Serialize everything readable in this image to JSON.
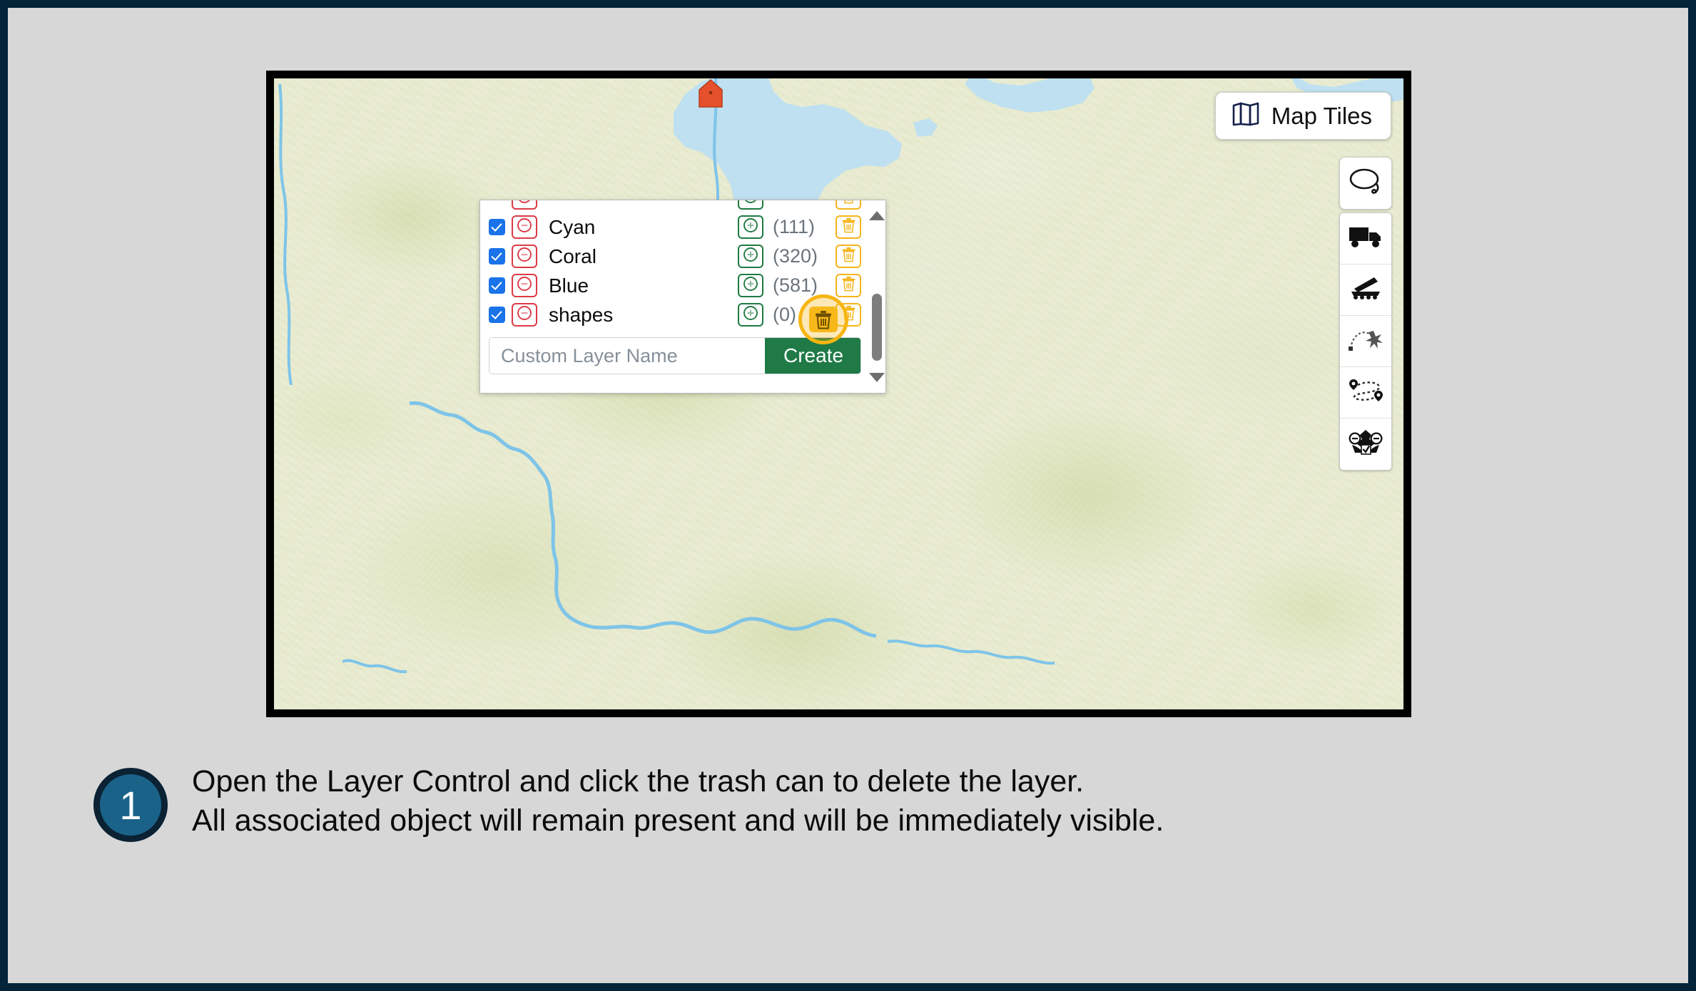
{
  "colors": {
    "outer_border": "#04243a",
    "page_background": "#d7d7d7",
    "map_frame": "#000000",
    "terrain": "#e9ecd2",
    "water": "#bfe0f0",
    "river": "#7ec4e8",
    "marker": "#e5512c",
    "checkbox_blue": "#1a73e8",
    "remove_red": "#dc3a47",
    "add_green": "#1e7a43",
    "trash_amber": "#f5b51b",
    "create_green": "#1f7a46",
    "count_gray": "#6c757d",
    "badge_fill": "#1b6289",
    "badge_ring": "#0a2233"
  },
  "map": {
    "tiles_button": {
      "label": "Map Tiles",
      "icon": "map-fold-icon"
    },
    "lasso_button": {
      "icon": "lasso-select-icon"
    },
    "tools": [
      {
        "icon": "truck-icon",
        "name": "tool-truck"
      },
      {
        "icon": "artillery-launcher-icon",
        "name": "tool-artillery"
      },
      {
        "icon": "trajectory-explosion-icon",
        "name": "tool-trajectory"
      },
      {
        "icon": "route-waypoints-icon",
        "name": "tool-route"
      },
      {
        "icon": "unit-zoom-select-icon",
        "name": "tool-unit-select"
      }
    ],
    "house_marker": {
      "icon": "house-marker-icon"
    }
  },
  "layer_panel": {
    "rows": [
      {
        "name": "",
        "count": "",
        "checked": true,
        "clipped": true,
        "remove_icon": "circle-minus-icon",
        "add_icon": "circle-plus-icon",
        "delete_icon": "trash-icon"
      },
      {
        "name": "Cyan",
        "count": "(111)",
        "checked": true,
        "clipped": false,
        "remove_icon": "circle-minus-icon",
        "add_icon": "circle-plus-icon",
        "delete_icon": "trash-icon"
      },
      {
        "name": "Coral",
        "count": "(320)",
        "checked": true,
        "clipped": false,
        "remove_icon": "circle-minus-icon",
        "add_icon": "circle-plus-icon",
        "delete_icon": "trash-icon"
      },
      {
        "name": "Blue",
        "count": "(581)",
        "checked": true,
        "clipped": false,
        "remove_icon": "circle-minus-icon",
        "add_icon": "circle-plus-icon",
        "delete_icon": "trash-icon"
      },
      {
        "name": "shapes",
        "count": "(0)",
        "checked": true,
        "clipped": false,
        "remove_icon": "circle-minus-icon",
        "add_icon": "circle-plus-icon",
        "delete_icon": "trash-icon"
      }
    ],
    "highlighted_delete": {
      "row": "shapes",
      "icon": "trash-icon"
    },
    "create": {
      "placeholder": "Custom Layer Name",
      "value": "",
      "button_label": "Create"
    },
    "scrollbar": {
      "up_icon": "triangle-up-icon",
      "down_icon": "triangle-down-icon"
    }
  },
  "caption": {
    "step_number": "1",
    "line1": "Open the Layer Control and click the trash can to delete the layer.",
    "line2": "All associated object will remain present and will be immediately visible."
  }
}
